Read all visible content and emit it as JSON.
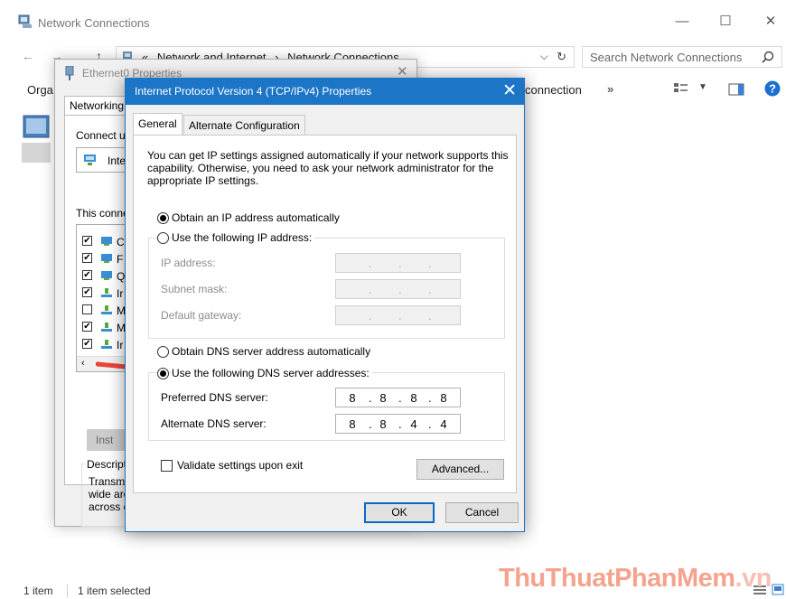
{
  "window": {
    "title": "Network Connections",
    "breadcrumb": [
      "Network and Internet",
      "Network Connections"
    ],
    "breadcrumb_prefix": "«",
    "search_placeholder": "Search Network Connections",
    "toolbar_left": "Orga",
    "toolbar_right": "connection",
    "toolbar_more": "»",
    "status_items": "1 item",
    "status_selected": "1 item selected"
  },
  "ethernet_dialog": {
    "title": "Ethernet0 Properties",
    "tab": "Networking",
    "connect_using": "Connect u",
    "adapter": "Inte",
    "this_connection": "This conne",
    "items": [
      {
        "checked": true,
        "letter": "C"
      },
      {
        "checked": true,
        "letter": "F"
      },
      {
        "checked": true,
        "letter": "Q"
      },
      {
        "checked": true,
        "letter": "Ir"
      },
      {
        "checked": false,
        "letter": "M"
      },
      {
        "checked": true,
        "letter": "M"
      },
      {
        "checked": true,
        "letter": "Ir"
      }
    ],
    "install_button": "Inst",
    "description_label": "Descripti",
    "description_lines": [
      "Transmi",
      "wide are",
      "across c"
    ]
  },
  "ipv4_dialog": {
    "title": "Internet Protocol Version 4 (TCP/IPv4) Properties",
    "tabs": [
      "General",
      "Alternate Configuration"
    ],
    "description": "You can get IP settings assigned automatically if your network supports this capability. Otherwise, you need to ask your network administrator for the appropriate IP settings.",
    "ip_auto_label": "Obtain an IP address automatically",
    "ip_manual_label": "Use the following IP address:",
    "ip_address_label": "IP address:",
    "subnet_label": "Subnet mask:",
    "gateway_label": "Default gateway:",
    "dns_auto_label": "Obtain DNS server address automatically",
    "dns_manual_label": "Use the following DNS server addresses:",
    "preferred_dns_label": "Preferred DNS server:",
    "preferred_dns": [
      "8",
      "8",
      "8",
      "8"
    ],
    "alternate_dns_label": "Alternate DNS server:",
    "alternate_dns": [
      "8",
      "8",
      "4",
      "4"
    ],
    "validate_label": "Validate settings upon exit",
    "advanced_button": "Advanced...",
    "ok_button": "OK",
    "cancel_button": "Cancel",
    "ip_mode": "automatic",
    "dns_mode": "manual",
    "validate_checked": false
  },
  "watermark": {
    "main": "ThuThuatPhanMem",
    "suffix": ".vn"
  },
  "colors": {
    "title_bar": "#1c75c6",
    "default_button_border": "#0a68c9",
    "arrow": "#e8453c"
  }
}
